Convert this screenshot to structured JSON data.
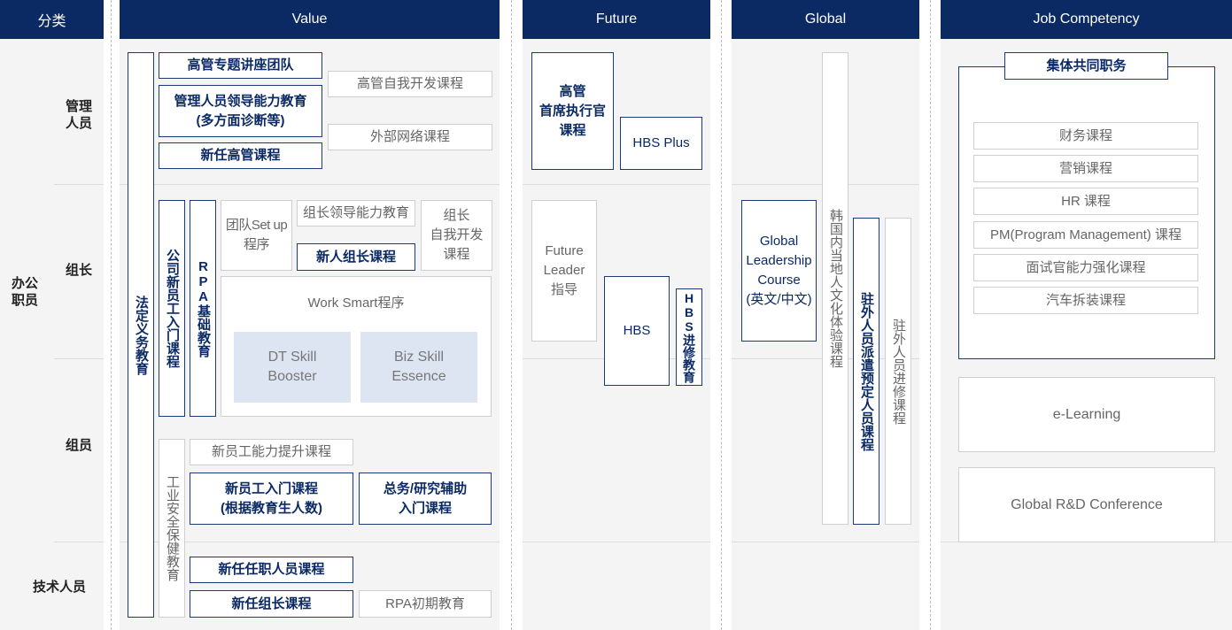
{
  "headers": {
    "category": "分类",
    "value": "Value",
    "future": "Future",
    "global": "Global",
    "job": "Job Competency"
  },
  "rows": {
    "office": "办公\n职员",
    "manager": "管理\n人员",
    "leader": "组长",
    "member": "组员",
    "technical": "技术人员"
  },
  "value": {
    "legal": "法定义务教育",
    "exec_lecture": "高管专题讲座团队",
    "mgr_leadership": "管理人员领导能力教育\n(多方面诊断等)",
    "new_exec": "新任高管课程",
    "exec_self_dev": "高管自我开发课程",
    "external_network": "外部网络课程",
    "company_intro": "公司新员工入门课程",
    "rpa_basic": "RPA基础教育",
    "team_setup": "团队Set up\n程序",
    "leader_leadership": "组长领导能力教育",
    "new_leader": "新人组长课程",
    "leader_self_dev": "组长\n自我开发\n课程",
    "work_smart": "Work Smart程序",
    "dt_skill": "DT Skill\nBooster",
    "biz_skill": "Biz Skill\nEssence",
    "safety": "工业安全保健教育",
    "new_emp_ability": "新员工能力提升课程",
    "new_emp_intro": "新员工入门课程\n(根据教育生人数)",
    "admin_intro": "总务/研究辅助\n入门课程",
    "new_staff": "新任任职人员课程",
    "new_group_leader": "新任组长课程",
    "rpa_initial": "RPA初期教育"
  },
  "future": {
    "ceo": "高管\n首席执行官\n课程",
    "hbs_plus": "HBS Plus",
    "future_leader": "Future\nLeader\n指导",
    "hbs": "HBS",
    "hbs_study": "HBS进修教育"
  },
  "global": {
    "glc": "Global\nLeadership\nCourse\n(英文/中文)",
    "korea_culture": "韩国内当地人文化体验课程",
    "expat_dispatch": "驻外人员派遣预定人员课程",
    "expat_study": "驻外人员进修课程"
  },
  "job": {
    "common_title": "集体共同职务",
    "items": [
      "财务课程",
      "营销课程",
      "HR 课程",
      "PM(Program Management) 课程",
      "面试官能力强化课程",
      "汽车拆装课程"
    ],
    "elearning": "e-Learning",
    "rd_conf": "Global R&D Conference"
  },
  "colors": {
    "header_bg": "#0b2a63",
    "dark_border": "#1b3a78",
    "skill_bg": "#dde5f3",
    "column_bg": "#f4f4f4"
  }
}
